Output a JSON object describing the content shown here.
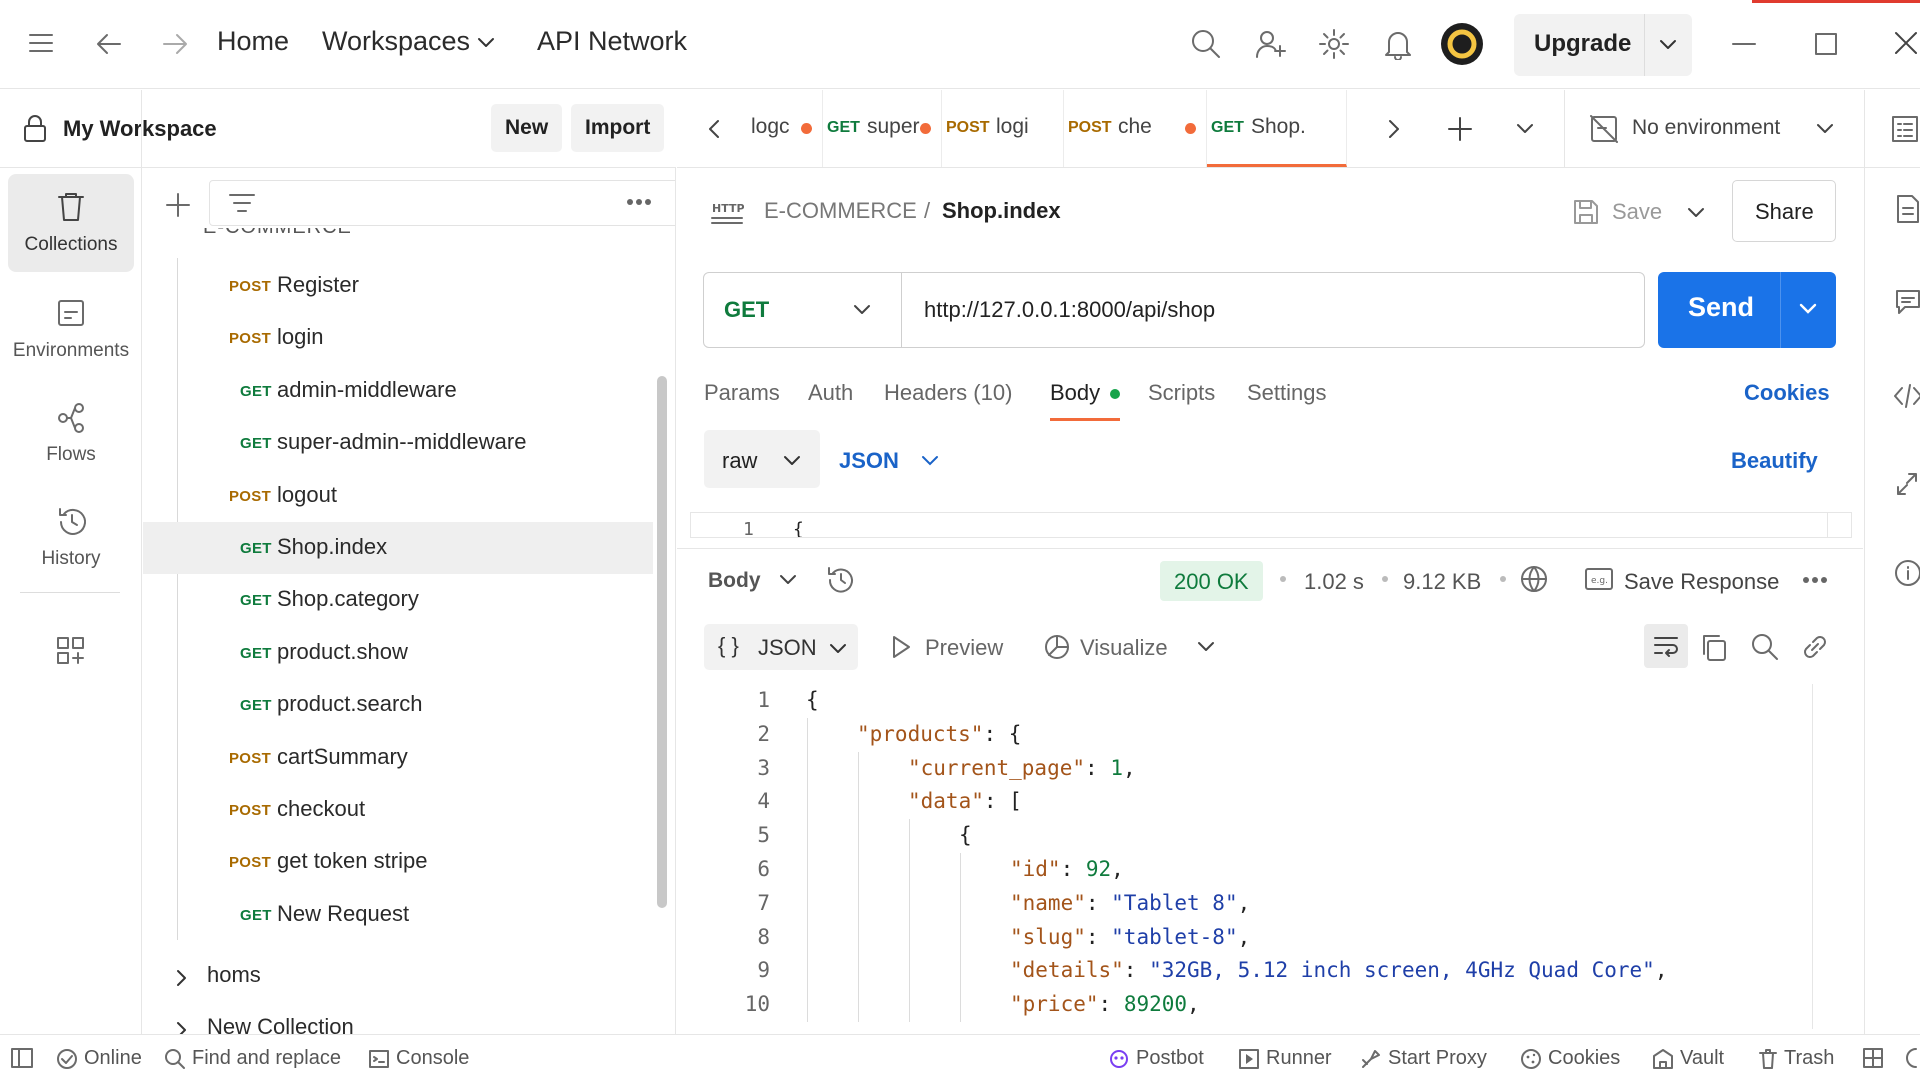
{
  "topbar": {
    "nav": {
      "home": "Home",
      "workspaces": "Workspaces",
      "api_network": "API Network"
    },
    "upgrade_label": "Upgrade"
  },
  "rail": [
    {
      "label": "Collections",
      "icon": "trash-bin-icon"
    },
    {
      "label": "Environments",
      "icon": "environment-icon"
    },
    {
      "label": "Flows",
      "icon": "flows-icon"
    },
    {
      "label": "History",
      "icon": "history-icon"
    }
  ],
  "workspace": {
    "title": "My Workspace",
    "new_label": "New",
    "import_label": "Import"
  },
  "sidebar": {
    "partial_header": "E-COMMERCE",
    "items": [
      {
        "method": "POST",
        "name": "Register"
      },
      {
        "method": "POST",
        "name": "login"
      },
      {
        "method": "GET",
        "name": "admin-middleware"
      },
      {
        "method": "GET",
        "name": "super-admin--middleware"
      },
      {
        "method": "POST",
        "name": "logout"
      },
      {
        "method": "GET",
        "name": "Shop.index"
      },
      {
        "method": "GET",
        "name": "Shop.category"
      },
      {
        "method": "GET",
        "name": "product.show"
      },
      {
        "method": "GET",
        "name": "product.search"
      },
      {
        "method": "POST",
        "name": "cartSummary"
      },
      {
        "method": "POST",
        "name": "checkout"
      },
      {
        "method": "POST",
        "name": "get token stripe"
      },
      {
        "method": "GET",
        "name": "New Request"
      }
    ],
    "collections": [
      {
        "name": "homs"
      },
      {
        "name": "New Collection"
      }
    ]
  },
  "tabs": [
    {
      "method": "",
      "name": "logc",
      "dot": true
    },
    {
      "method": "GET",
      "name": "super",
      "dot": true
    },
    {
      "method": "POST",
      "name": "logi",
      "dot": false
    },
    {
      "method": "POST",
      "name": "che",
      "dot": true
    },
    {
      "method": "GET",
      "name": "Shop.",
      "dot": false
    }
  ],
  "environment": {
    "label": "No environment"
  },
  "request": {
    "breadcrumb_parent": "E-COMMERCE",
    "breadcrumb_sep": "/",
    "breadcrumb_name": "Shop.index",
    "save_label": "Save",
    "share_label": "Share",
    "method": "GET",
    "url": "http://127.0.0.1:8000/api/shop",
    "send_label": "Send",
    "tabs": {
      "params": "Params",
      "auth": "Auth",
      "headers": "Headers",
      "headers_count": "(10)",
      "body": "Body",
      "scripts": "Scripts",
      "settings": "Settings"
    },
    "cookies_label": "Cookies",
    "body_mode": "raw",
    "body_format": "JSON",
    "beautify_label": "Beautify",
    "body_line_no": "1",
    "body_line_text": "{"
  },
  "response": {
    "body_label": "Body",
    "status": "200 OK",
    "time": "1.02 s",
    "size": "9.12 KB",
    "save_response_label": "Save Response",
    "format_label": "JSON",
    "preview_label": "Preview",
    "visualize_label": "Visualize",
    "lines": [
      {
        "n": "1",
        "indent": 0,
        "parts": [
          [
            "p",
            "{"
          ]
        ]
      },
      {
        "n": "2",
        "indent": 1,
        "parts": [
          [
            "k",
            "\"products\""
          ],
          [
            "p",
            ": {"
          ]
        ]
      },
      {
        "n": "3",
        "indent": 2,
        "parts": [
          [
            "k",
            "\"current_page\""
          ],
          [
            "p",
            ": "
          ],
          [
            "n",
            "1"
          ],
          [
            "p",
            ","
          ]
        ]
      },
      {
        "n": "4",
        "indent": 2,
        "parts": [
          [
            "k",
            "\"data\""
          ],
          [
            "p",
            ": ["
          ]
        ]
      },
      {
        "n": "5",
        "indent": 3,
        "parts": [
          [
            "p",
            "{"
          ]
        ]
      },
      {
        "n": "6",
        "indent": 4,
        "parts": [
          [
            "k",
            "\"id\""
          ],
          [
            "p",
            ": "
          ],
          [
            "n",
            "92"
          ],
          [
            "p",
            ","
          ]
        ]
      },
      {
        "n": "7",
        "indent": 4,
        "parts": [
          [
            "k",
            "\"name\""
          ],
          [
            "p",
            ": "
          ],
          [
            "s",
            "\"Tablet 8\""
          ],
          [
            "p",
            ","
          ]
        ]
      },
      {
        "n": "8",
        "indent": 4,
        "parts": [
          [
            "k",
            "\"slug\""
          ],
          [
            "p",
            ": "
          ],
          [
            "s",
            "\"tablet-8\""
          ],
          [
            "p",
            ","
          ]
        ]
      },
      {
        "n": "9",
        "indent": 4,
        "parts": [
          [
            "k",
            "\"details\""
          ],
          [
            "p",
            ": "
          ],
          [
            "s",
            "\"32GB, 5.12 inch screen, 4GHz Quad Core\""
          ],
          [
            "p",
            ","
          ]
        ]
      },
      {
        "n": "10",
        "indent": 4,
        "parts": [
          [
            "k",
            "\"price\""
          ],
          [
            "p",
            ": "
          ],
          [
            "n",
            "89200"
          ],
          [
            "p",
            ","
          ]
        ]
      }
    ]
  },
  "statusbar": {
    "online": "Online",
    "find_replace": "Find and replace",
    "console": "Console",
    "postbot": "Postbot",
    "runner": "Runner",
    "start_proxy": "Start Proxy",
    "cookies": "Cookies",
    "vault": "Vault",
    "trash": "Trash"
  },
  "colors": {
    "accent": "#f26b3a",
    "send": "#1a73e8",
    "get": "#0f7b3d",
    "post": "#a86a00",
    "status_ok_bg": "#e3f4e8",
    "status_ok_text": "#0f7b3d"
  }
}
